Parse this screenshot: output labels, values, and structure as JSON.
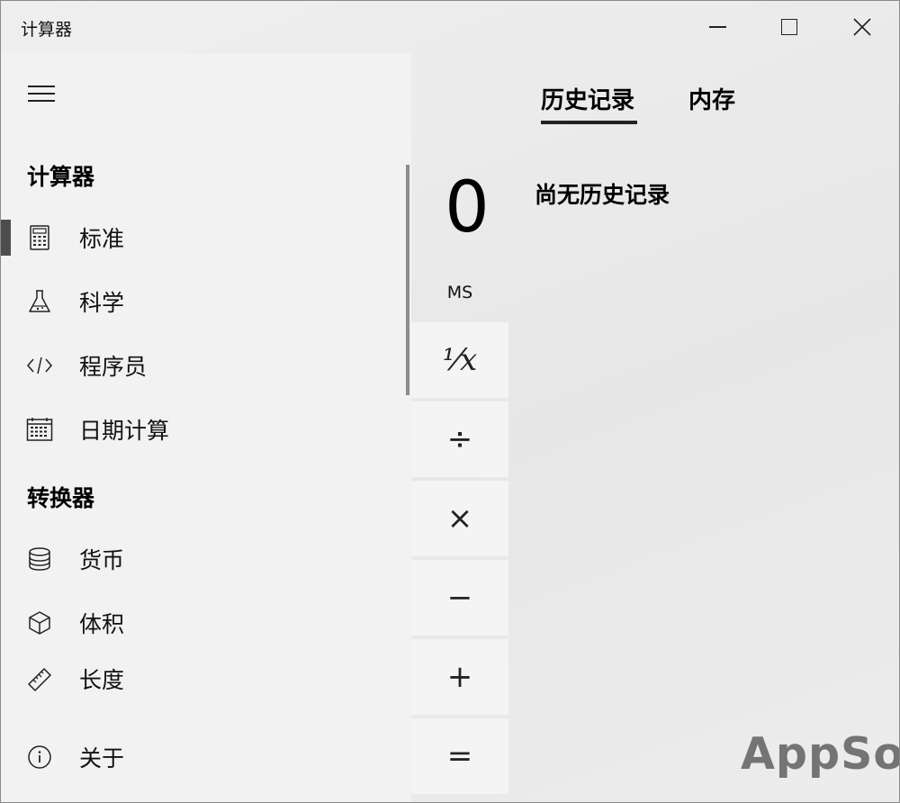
{
  "window": {
    "title": "计算器"
  },
  "nav": {
    "sections": {
      "calculator": "计算器",
      "converter": "转换器"
    },
    "items": [
      {
        "label": "标准",
        "icon": "calculator-icon",
        "selected": true
      },
      {
        "label": "科学",
        "icon": "flask-icon"
      },
      {
        "label": "程序员",
        "icon": "code-icon"
      },
      {
        "label": "日期计算",
        "icon": "calendar-icon"
      },
      {
        "label": "货币",
        "icon": "coins-icon"
      },
      {
        "label": "体积",
        "icon": "cube-icon"
      },
      {
        "label": "长度",
        "icon": "ruler-icon"
      }
    ],
    "about": {
      "label": "关于",
      "icon": "info-icon"
    }
  },
  "calculator": {
    "display": "0",
    "memory_store": "MS",
    "keys": {
      "reciprocal": "⅟x",
      "divide": "÷",
      "multiply": "×",
      "subtract": "−",
      "add": "+",
      "equals": "="
    }
  },
  "history": {
    "tabs": [
      "历史记录",
      "内存"
    ],
    "active_tab": 0,
    "empty_message": "尚无历史记录"
  },
  "watermark": "AppSo",
  "colors": {
    "nav_bg": "#f2f2f2",
    "key_bg": "#f4f4f4",
    "selection_bar": "#4d4d4d"
  }
}
